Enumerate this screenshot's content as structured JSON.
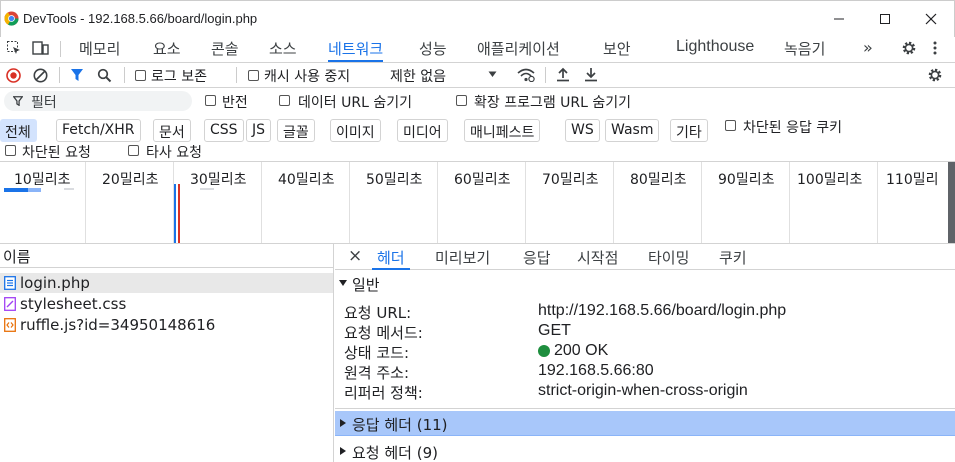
{
  "window": {
    "title": "DevTools - 192.168.5.66/board/login.php"
  },
  "main_tabs": [
    "메모리",
    "요소",
    "콘솔",
    "소스",
    "네트워크",
    "성능",
    "애플리케이션",
    "보안",
    "Lighthouse",
    "녹음기",
    "»"
  ],
  "toolbar": {
    "preserve_log": "로그 보존",
    "disable_cache": "캐시 사용 중지",
    "throttling": "제한 없음"
  },
  "filter": {
    "placeholder": "필터",
    "invert": "반전",
    "hide_data_urls": "데이터 URL 숨기기",
    "hide_extension_urls": "확장 프로그램 URL 숨기기",
    "types": [
      "전체",
      "Fetch/XHR",
      "문서",
      "CSS",
      "JS",
      "글꼴",
      "이미지",
      "미디어",
      "매니페스트",
      "WS",
      "Wasm",
      "기타"
    ],
    "blocked_cookies": "차단된 응답 쿠키",
    "blocked_requests": "차단된 요청",
    "third_party": "타사 요청"
  },
  "overview_ticks": [
    "10밀리초",
    "20밀리초",
    "30밀리초",
    "40밀리초",
    "50밀리초",
    "60밀리초",
    "70밀리초",
    "80밀리초",
    "90밀리초",
    "100밀리초",
    "110밀리"
  ],
  "requests": {
    "column_name": "이름",
    "items": [
      {
        "name": "login.php",
        "type": "doc"
      },
      {
        "name": "stylesheet.css",
        "type": "css"
      },
      {
        "name": "ruffle.js?id=34950148616",
        "type": "js"
      }
    ]
  },
  "detail": {
    "close": "×",
    "tabs": [
      "헤더",
      "미리보기",
      "응답",
      "시작점",
      "타이밍",
      "쿠키"
    ],
    "general_title": "일반",
    "general": [
      {
        "key": "요청 URL:",
        "value": "http://192.168.5.66/board/login.php"
      },
      {
        "key": "요청 메서드:",
        "value": "GET"
      },
      {
        "key": "상태 코드:",
        "value": "200 OK"
      },
      {
        "key": "원격 주소:",
        "value": "192.168.5.66:80"
      },
      {
        "key": "리퍼러 정책:",
        "value": "strict-origin-when-cross-origin"
      }
    ],
    "response_headers": "응답 헤더 (11)",
    "request_headers": "요청 헤더 (9)"
  },
  "colors": {
    "accent": "#1a73e8",
    "record_red": "#d93025",
    "status_ok": "#1e8e3e",
    "selected_section": "#a8c7fa"
  }
}
